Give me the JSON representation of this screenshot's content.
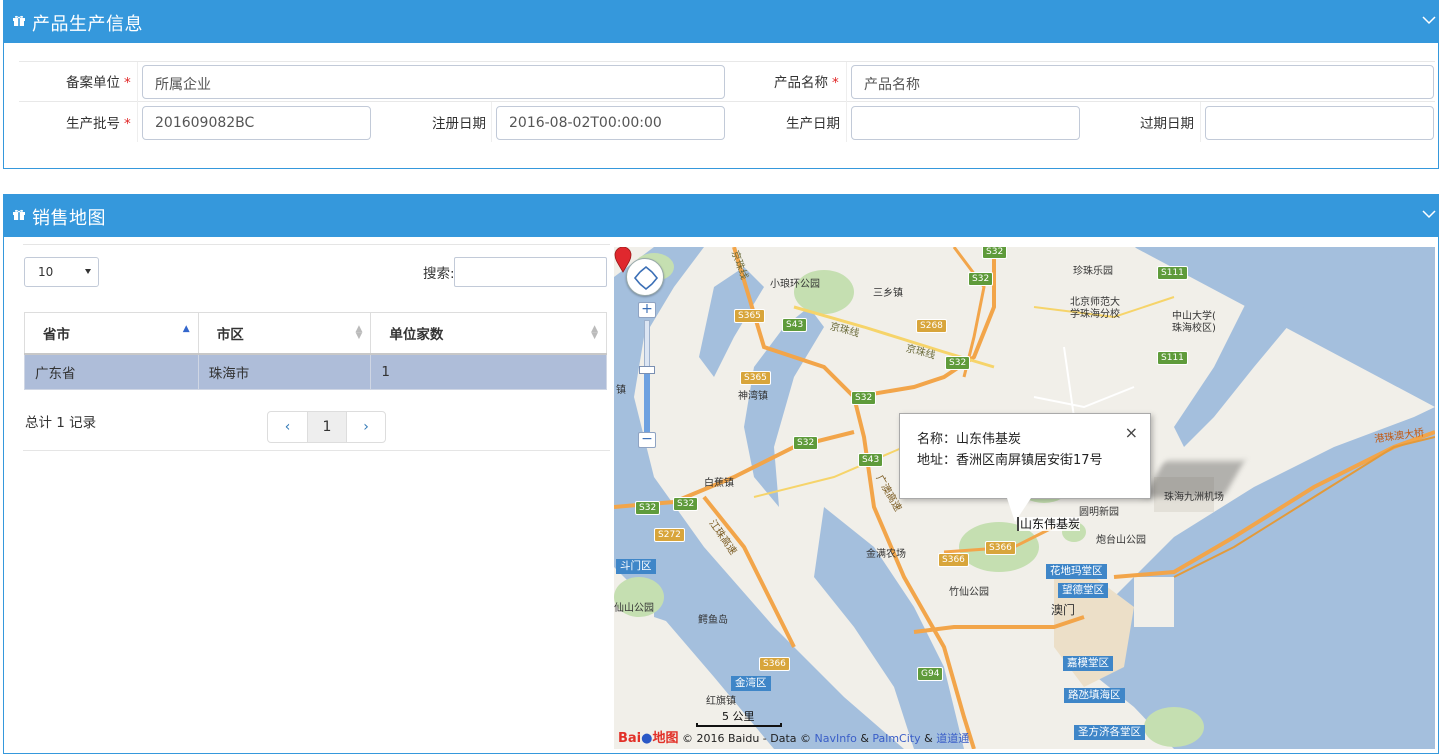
{
  "panels": {
    "info_title": "产品生产信息",
    "map_title": "销售地图"
  },
  "form": {
    "filing_unit_label": "备案单位",
    "filing_unit_value": "所属企业",
    "product_name_label": "产品名称",
    "product_name_value": "产品名称",
    "batch_no_label": "生产批号",
    "batch_no_value": "201609082BC",
    "register_date_label": "注册日期",
    "register_date_value": "2016-08-02T00:00:00",
    "production_date_label": "生产日期",
    "production_date_value": "",
    "expiry_date_label": "过期日期",
    "expiry_date_value": "",
    "required_mark": "*"
  },
  "table_controls": {
    "page_length": "10",
    "search_label": "搜索:",
    "search_value": ""
  },
  "table": {
    "columns": [
      "省市",
      "市区",
      "单位家数"
    ],
    "rows": [
      [
        "广东省",
        "珠海市",
        "1"
      ]
    ]
  },
  "pagination": {
    "total_text": "总计 1 记录",
    "prev": "‹",
    "current_page": "1",
    "next": "›"
  },
  "map": {
    "popup": {
      "name_line": "名称：山东伟基炭",
      "address_line": "地址：香洲区南屏镇居安街17号",
      "close": "×"
    },
    "marker_label": "山东伟基炭",
    "scale": "5 公里",
    "copyright_prefix": "© 2016 Baidu - Data ©",
    "navinfo": "NavInfo",
    "amp1": "&",
    "palmcity": "PalmCity",
    "amp2": "&",
    "daodaotong": "道道通",
    "logo_text_1": "Bai",
    "logo_text_2": "地图",
    "places": [
      {
        "text": "小琅环公园"
      },
      {
        "text": "三乡镇"
      },
      {
        "text": "珍珠乐园"
      },
      {
        "text": "北京师范大"
      },
      {
        "text": "学珠海分校"
      },
      {
        "text": "中山大学("
      },
      {
        "text": "珠海校区)"
      },
      {
        "text": "神湾镇"
      },
      {
        "text": "白蕉镇"
      },
      {
        "text": "金满农场"
      },
      {
        "text": "竹仙公园"
      },
      {
        "text": "圆明新园"
      },
      {
        "text": "炮台山公园"
      },
      {
        "text": "珠海九洲机场"
      },
      {
        "text": "澳门"
      },
      {
        "text": "鳄鱼岛"
      },
      {
        "text": "红旗镇"
      },
      {
        "text": "镇"
      },
      {
        "text": "仙山公园"
      }
    ],
    "districts": [
      "斗门区",
      "花地玛堂区",
      "望德堂区",
      "嘉模堂区",
      "路氹填海区",
      "圣方济各堂区",
      "金湾区",
      "港珠澳大桥"
    ],
    "roads": [
      "S32",
      "S32",
      "S111",
      "S365",
      "S43",
      "S268",
      "S32",
      "S111",
      "S365",
      "S32",
      "S32",
      "S43",
      "S32",
      "S32",
      "S272",
      "S366",
      "S366",
      "S366",
      "G94"
    ],
    "rail_labels": [
      "京珠线",
      "京珠线",
      "京珠线"
    ],
    "highway_labels": [
      "广澳高速",
      "江珠高速"
    ]
  }
}
